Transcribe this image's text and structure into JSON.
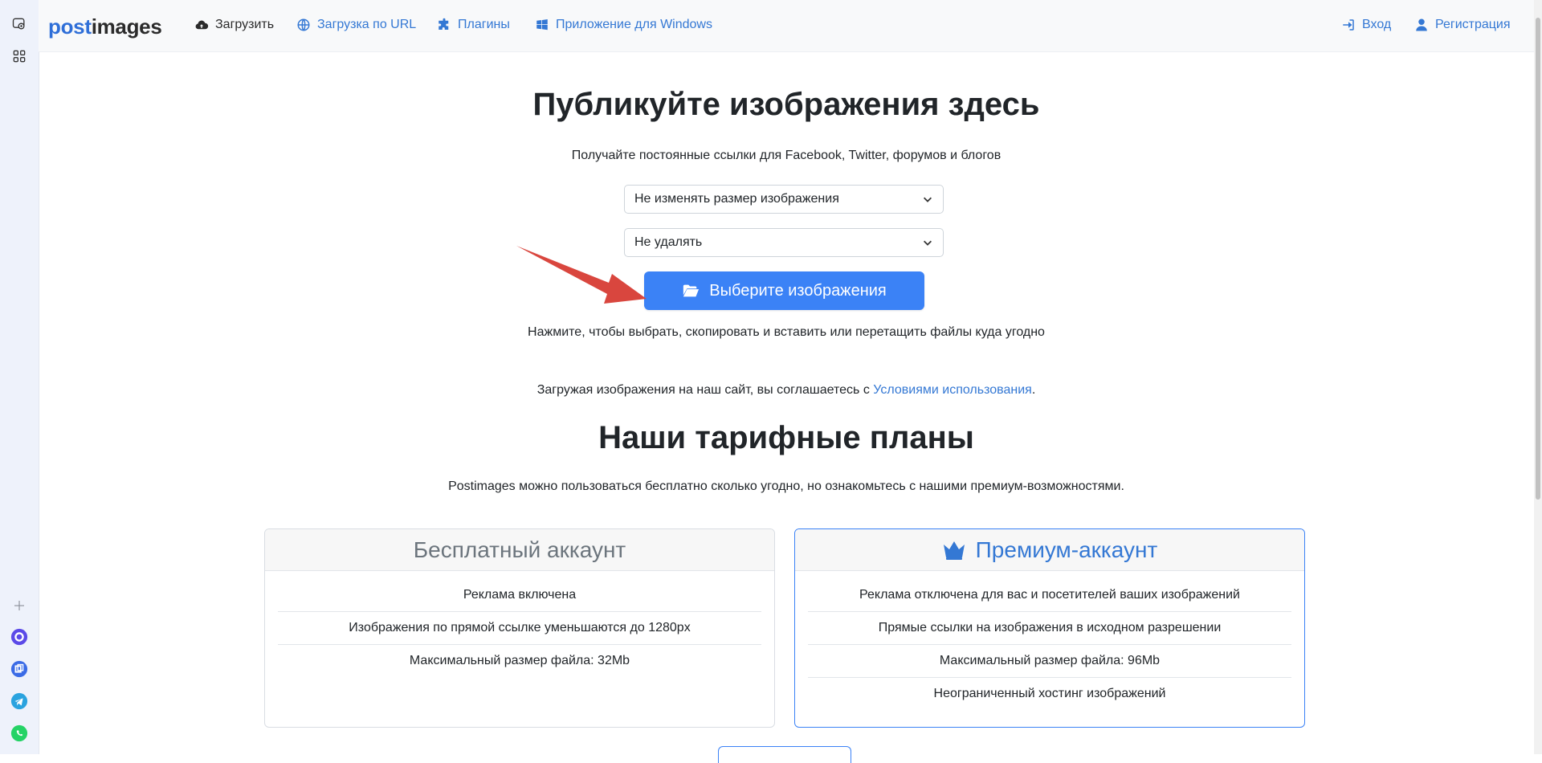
{
  "browser": {
    "sidepanel_icons": [
      "screenshot-icon",
      "apps-grid-icon",
      "plus-icon",
      "messenger-icon",
      "app-icon",
      "telegram-icon",
      "whatsapp-icon"
    ]
  },
  "navbar": {
    "brand_part1": "post",
    "brand_part2": "images",
    "items": [
      {
        "label": "Загрузить",
        "icon": "cloud-upload-icon",
        "active": true
      },
      {
        "label": "Загрузка по URL",
        "icon": "globe-icon"
      },
      {
        "label": "Плагины",
        "icon": "puzzle-icon"
      },
      {
        "label": "Приложение для Windows",
        "icon": "windows-icon"
      }
    ],
    "right": [
      {
        "label": "Вход",
        "icon": "sign-in-icon"
      },
      {
        "label": "Регистрация",
        "icon": "user-icon"
      }
    ]
  },
  "hero": {
    "title": "Публикуйте изображения здесь",
    "subtitle": "Получайте постоянные ссылки для Facebook, Twitter, форумов и блогов",
    "resize_select": "Не изменять размер изображения",
    "expiry_select": "Не удалять",
    "choose_button": "Выберите изображения",
    "hint": "Нажмите, чтобы выбрать, скопировать и вставить или перетащить файлы куда угодно",
    "terms_prefix": "Загружая изображения на наш сайт, вы соглашаетесь с ",
    "terms_link": "Условиями использования",
    "terms_suffix": "."
  },
  "plans": {
    "title": "Наши тарифные планы",
    "description": "Postimages можно пользоваться бесплатно сколько угодно, но ознакомьтесь с нашими премиум-возможностями.",
    "free": {
      "title": "Бесплатный аккаунт",
      "features": [
        "Реклама включена",
        "Изображения по прямой ссылке уменьшаются до 1280px",
        "Максимальный размер файла: 32Mb"
      ]
    },
    "premium": {
      "title": "Премиум-аккаунт",
      "icon": "crown-icon",
      "features": [
        "Реклама отключена для вас и посетителей ваших изображений",
        "Прямые ссылки на изображения в исходном разрешении",
        "Максимальный размер файла: 96Mb",
        "Неограниченный хостинг изображений"
      ]
    }
  },
  "colors": {
    "accent": "#3b82f6",
    "link": "#3478d4",
    "annotation_arrow": "#d9463e"
  }
}
